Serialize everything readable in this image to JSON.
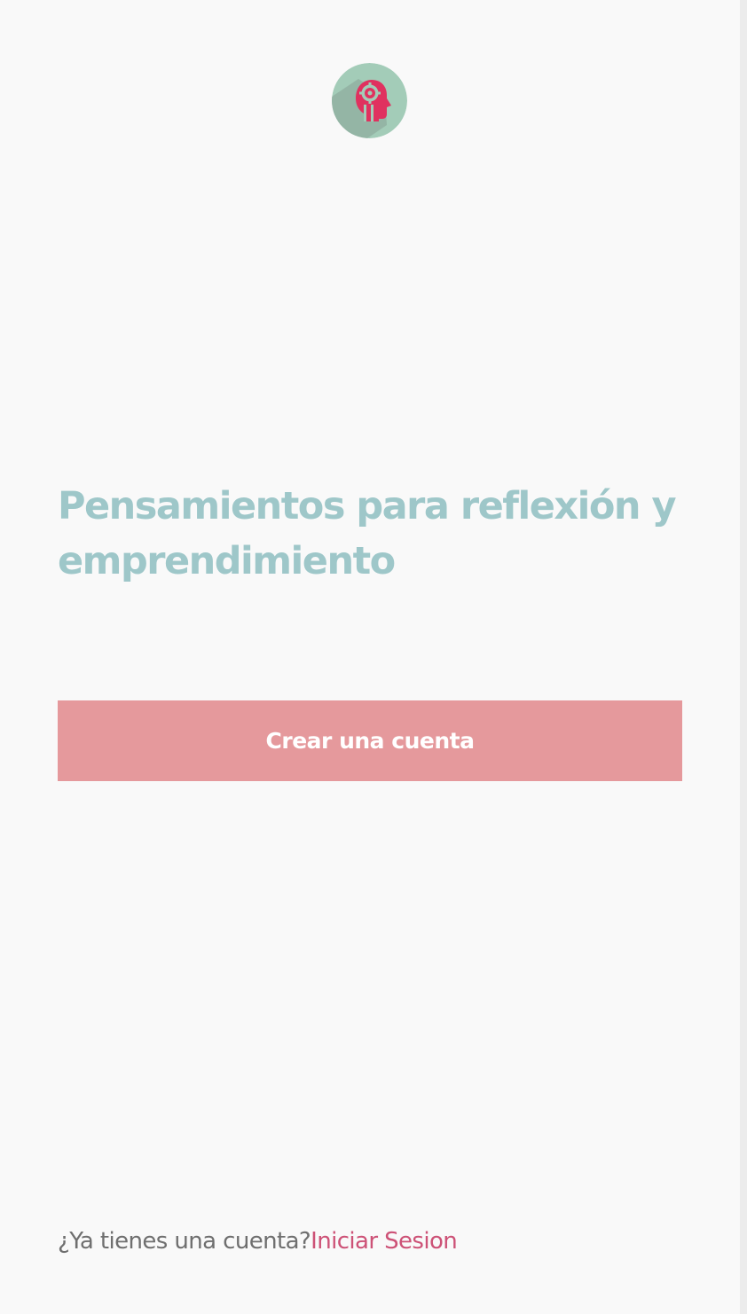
{
  "logo": {
    "icon": "head-brain-icon",
    "background_color": "#a3ccb8",
    "shadow_color": "#92b3a3",
    "icon_color": "#e0315f"
  },
  "hero": {
    "headline": "Pensamientos para reflexión y emprendimiento",
    "headline_color": "#9ec7c9"
  },
  "actions": {
    "create_account_label": "Crear una cuenta",
    "create_account_color": "#e5999c"
  },
  "footer": {
    "question": "¿Ya tienes una cuenta?",
    "login_link": "Iniciar Sesion",
    "link_color": "#cd5277"
  }
}
